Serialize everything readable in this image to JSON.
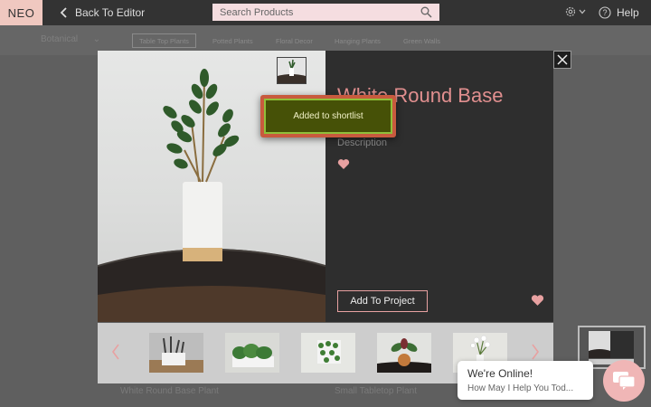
{
  "header": {
    "logo": "NEO",
    "back_label": "Back To Editor",
    "search_placeholder": "Search Products",
    "help_label": "Help"
  },
  "background": {
    "category_dropdown": "Botanical",
    "chips": [
      "Table Top Plants",
      "Potted Plants",
      "Floral Decor",
      "Hanging Plants",
      "Green Walls"
    ],
    "selected_chip": "Table Top Plants",
    "product_names": [
      "White Round Base Plant",
      "Small Tabletop Plant"
    ]
  },
  "modal": {
    "title": "White Round Base",
    "description_label": "Description",
    "add_button": "Add To Project",
    "toast": "Added to shortlist",
    "thumbnail_count": 5
  },
  "chat": {
    "title": "We're Online!",
    "subtitle": "How May I Help You Tod..."
  },
  "colors": {
    "accent": "#e18f8f",
    "logo_bg": "#f0c8c0",
    "toast_bg": "#465107",
    "toast_border": "#c85a3e"
  }
}
